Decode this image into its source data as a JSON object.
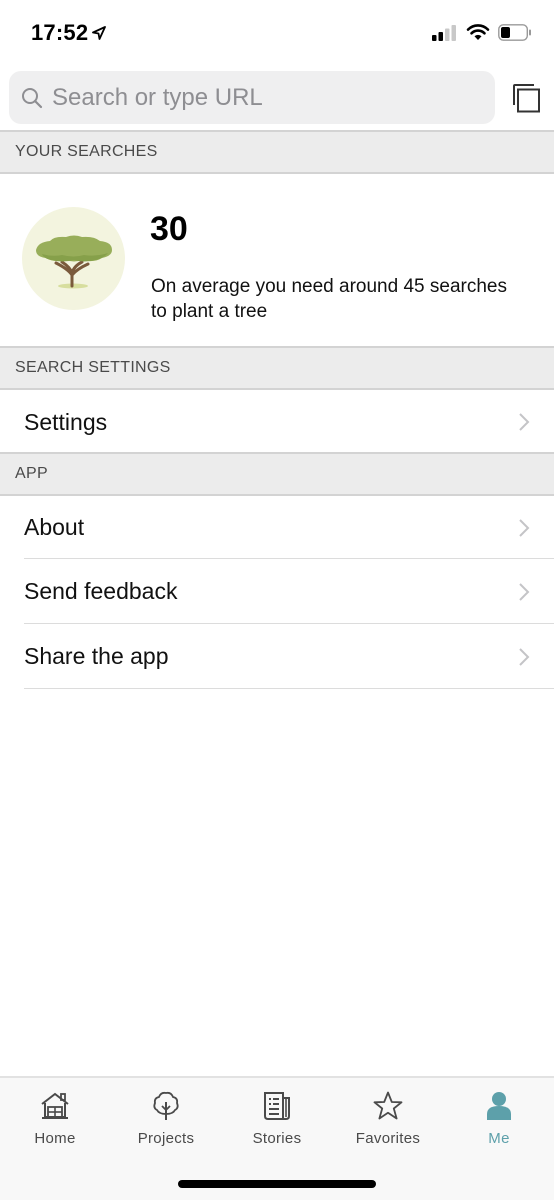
{
  "status_bar": {
    "time": "17:52",
    "icons": [
      "location-arrow-icon",
      "cellular-signal-icon",
      "wifi-icon",
      "battery-icon"
    ]
  },
  "search": {
    "placeholder": "Search or type URL",
    "value": "",
    "search_icon": "magnifier-icon",
    "tabs_icon": "tabs-overview-icon"
  },
  "your_searches": {
    "header": "YOUR SEARCHES",
    "count": "30",
    "description": "On average you need around 45 searches to plant a tree",
    "illustration": "tree-icon"
  },
  "search_settings": {
    "header": "SEARCH SETTINGS",
    "items": [
      {
        "label": "Settings"
      }
    ]
  },
  "app_section": {
    "header": "APP",
    "items": [
      {
        "label": "About"
      },
      {
        "label": "Send feedback"
      },
      {
        "label": "Share the app"
      }
    ]
  },
  "tab_bar": {
    "active_color": "#5da0aa",
    "tabs": [
      {
        "label": "Home",
        "icon": "house-icon",
        "active": false
      },
      {
        "label": "Projects",
        "icon": "tree-outline-icon",
        "active": false
      },
      {
        "label": "Stories",
        "icon": "newspaper-icon",
        "active": false
      },
      {
        "label": "Favorites",
        "icon": "star-icon",
        "active": false
      },
      {
        "label": "Me",
        "icon": "person-icon",
        "active": true
      }
    ]
  }
}
